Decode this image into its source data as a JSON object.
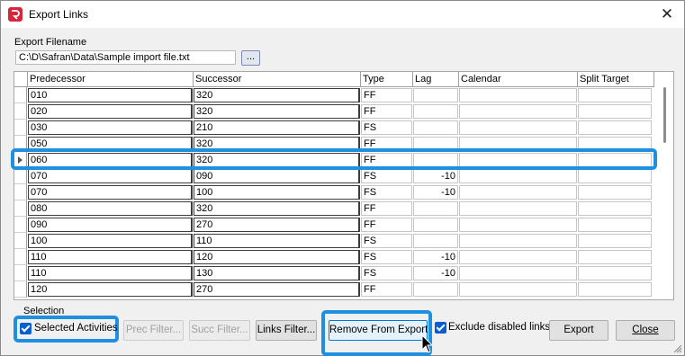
{
  "window": {
    "title": "Export Links",
    "close_glyph": "✕"
  },
  "export_filename": {
    "label": "Export Filename",
    "value": "C:\\D\\Safran\\Data\\Sample import file.txt",
    "browse_label": "..."
  },
  "grid": {
    "columns": [
      "Predecessor",
      "Successor",
      "Type",
      "Lag",
      "Calendar",
      "Split Target"
    ],
    "selected_row_index": 4,
    "rows": [
      {
        "predecessor": "010",
        "successor": "320",
        "type": "FF",
        "lag": "",
        "calendar": "",
        "split_target": ""
      },
      {
        "predecessor": "020",
        "successor": "320",
        "type": "FF",
        "lag": "",
        "calendar": "",
        "split_target": ""
      },
      {
        "predecessor": "030",
        "successor": "210",
        "type": "FS",
        "lag": "",
        "calendar": "",
        "split_target": ""
      },
      {
        "predecessor": "050",
        "successor": "320",
        "type": "FF",
        "lag": "",
        "calendar": "",
        "split_target": ""
      },
      {
        "predecessor": "060",
        "successor": "320",
        "type": "FF",
        "lag": "",
        "calendar": "",
        "split_target": ""
      },
      {
        "predecessor": "070",
        "successor": "090",
        "type": "FS",
        "lag": "-10",
        "calendar": "",
        "split_target": ""
      },
      {
        "predecessor": "070",
        "successor": "100",
        "type": "FS",
        "lag": "-10",
        "calendar": "",
        "split_target": ""
      },
      {
        "predecessor": "080",
        "successor": "320",
        "type": "FF",
        "lag": "",
        "calendar": "",
        "split_target": ""
      },
      {
        "predecessor": "090",
        "successor": "270",
        "type": "FF",
        "lag": "",
        "calendar": "",
        "split_target": ""
      },
      {
        "predecessor": "100",
        "successor": "110",
        "type": "FS",
        "lag": "",
        "calendar": "",
        "split_target": ""
      },
      {
        "predecessor": "110",
        "successor": "120",
        "type": "FS",
        "lag": "-10",
        "calendar": "",
        "split_target": ""
      },
      {
        "predecessor": "110",
        "successor": "130",
        "type": "FS",
        "lag": "-10",
        "calendar": "",
        "split_target": ""
      },
      {
        "predecessor": "120",
        "successor": "270",
        "type": "FF",
        "lag": "",
        "calendar": "",
        "split_target": ""
      }
    ]
  },
  "selection": {
    "label": "Selection",
    "selected_activities_label": "Selected Activities",
    "selected_activities_checked": true,
    "prec_filter_label": "Prec Filter...",
    "succ_filter_label": "Succ Filter...",
    "links_filter_label": "Links Filter..."
  },
  "actions": {
    "remove_from_export_label": "Remove From Export",
    "exclude_disabled_label": "Exclude disabled links",
    "exclude_disabled_checked": true,
    "export_label": "Export",
    "close_label": "Close"
  },
  "colors": {
    "highlight": "#1f8fe0",
    "checkbox": "#0a5fd0",
    "app_icon": "#d6263b"
  }
}
